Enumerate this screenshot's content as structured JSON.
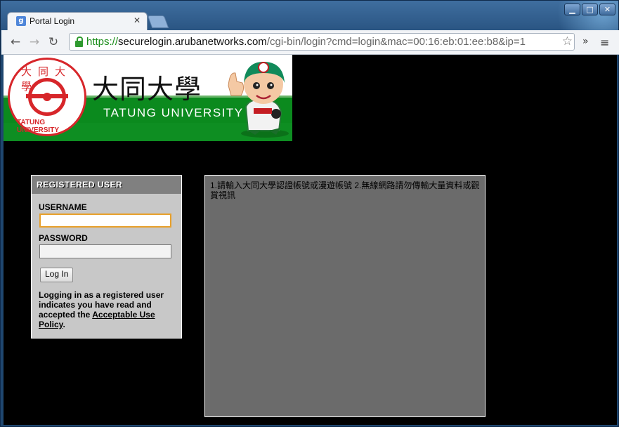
{
  "browser": {
    "tab_title": "Portal Login",
    "tab_favicon": "g",
    "tab_close": "✕",
    "url_scheme": "https://",
    "url_host": "securelogin.arubanetworks.com",
    "url_path": "/cgi-bin/login?cmd=login&mac=00:16:eb:01:ee:b8&ip=1",
    "icons": {
      "back": "←",
      "forward": "→",
      "reload": "↻",
      "bookmark": "☆",
      "extensions": "»",
      "menu": "≡",
      "minimize": "▁",
      "maximize": "□",
      "close": "✕"
    }
  },
  "banner": {
    "title": "大同大學",
    "subtitle": "TATUNG UNIVERSITY",
    "seal_top": "大同大學",
    "seal_bottom": "TATUNG UNIVERSITY"
  },
  "login": {
    "header": "REGISTERED USER",
    "username_label": "USERNAME",
    "username_value": "",
    "password_label": "PASSWORD",
    "password_value": "",
    "submit_label": "Log In",
    "note_text": "Logging in as a registered user indicates you have read and accepted the ",
    "policy_link": "Acceptable Use Policy",
    "note_end": "."
  },
  "message": {
    "text": "1.請輸入大同大學認證帳號或漫遊帳號 2.無線網路請勿傳輸大量資料或觀賞視訊"
  },
  "colors": {
    "page_bg": "#000000",
    "banner_green": "#0b8a1e",
    "seal_red": "#d7262a",
    "login_panel": "#c8c8c8",
    "message_panel": "#6b6b6b",
    "focus_border": "#e8a02a"
  }
}
